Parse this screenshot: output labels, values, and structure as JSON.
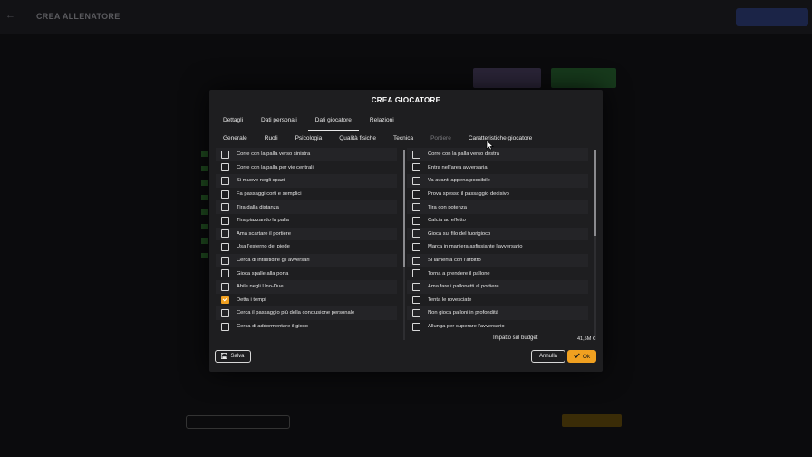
{
  "modal": {
    "title": "CREA GIOCATORE",
    "tabs_main": [
      {
        "label": "Dettagli",
        "active": false
      },
      {
        "label": "Dati personali",
        "active": false
      },
      {
        "label": "Dati giocatore",
        "active": true
      },
      {
        "label": "Relazioni",
        "active": false
      }
    ],
    "tabs_sub": [
      {
        "label": "Generale",
        "active": false,
        "disabled": false
      },
      {
        "label": "Ruoli",
        "active": false,
        "disabled": false
      },
      {
        "label": "Psicologia",
        "active": false,
        "disabled": false
      },
      {
        "label": "Qualità fisiche",
        "active": false,
        "disabled": false
      },
      {
        "label": "Tecnica",
        "active": false,
        "disabled": false
      },
      {
        "label": "Portiere",
        "active": false,
        "disabled": true
      },
      {
        "label": "Caratteristiche giocatore",
        "active": true,
        "disabled": false
      }
    ],
    "traits_left": [
      {
        "label": "Corre con la palla verso sinistra",
        "checked": false
      },
      {
        "label": "Corre con la palla per vie centrali",
        "checked": false
      },
      {
        "label": "Si muove negli spazi",
        "checked": false
      },
      {
        "label": "Fa passaggi corti e semplici",
        "checked": false
      },
      {
        "label": "Tira dalla distanza",
        "checked": false
      },
      {
        "label": "Tira piazzando la palla",
        "checked": false
      },
      {
        "label": "Ama scartare il portiere",
        "checked": false
      },
      {
        "label": "Usa l'esterno del piede",
        "checked": false
      },
      {
        "label": "Cerca di infastidire gli avversari",
        "checked": false
      },
      {
        "label": "Gioca spalle alla porta",
        "checked": false
      },
      {
        "label": "Abile negli Uno-Due",
        "checked": false
      },
      {
        "label": "Detta i tempi",
        "checked": true
      },
      {
        "label": "Cerca il passaggio più della conclusione personale",
        "checked": false
      },
      {
        "label": "Cerca di addormentare il gioco",
        "checked": false
      }
    ],
    "traits_right": [
      {
        "label": "Corre con la palla verso destra",
        "checked": false
      },
      {
        "label": "Entra nell'area avversaria",
        "checked": false
      },
      {
        "label": "Va avanti appena possibile",
        "checked": false
      },
      {
        "label": "Prova spesso il passaggio decisivo",
        "checked": false
      },
      {
        "label": "Tira con potenza",
        "checked": false
      },
      {
        "label": "Calcia ad effetto",
        "checked": false
      },
      {
        "label": "Gioca sul filo del fuorigioco",
        "checked": false
      },
      {
        "label": "Marca in maniera asfissiante l'avversario",
        "checked": false
      },
      {
        "label": "Si lamenta con l'arbitro",
        "checked": false
      },
      {
        "label": "Torna a prendere il pallone",
        "checked": false
      },
      {
        "label": "Ama fare i pallonetti al portiere",
        "checked": false
      },
      {
        "label": "Tenta le rovesciate",
        "checked": false
      },
      {
        "label": "Non gioca palloni in profondità",
        "checked": false
      },
      {
        "label": "Allunga per superare l'avversario",
        "checked": false
      }
    ],
    "impact_label": "Impatto sul budget",
    "impact_value": "41,5M €",
    "save_label": "Salva",
    "cancel_label": "Annulla",
    "ok_label": "Ok"
  },
  "background": {
    "title": "CREA ALLENATORE"
  },
  "colors": {
    "accent": "#f0a020",
    "modal_bg": "#1e1e20"
  }
}
